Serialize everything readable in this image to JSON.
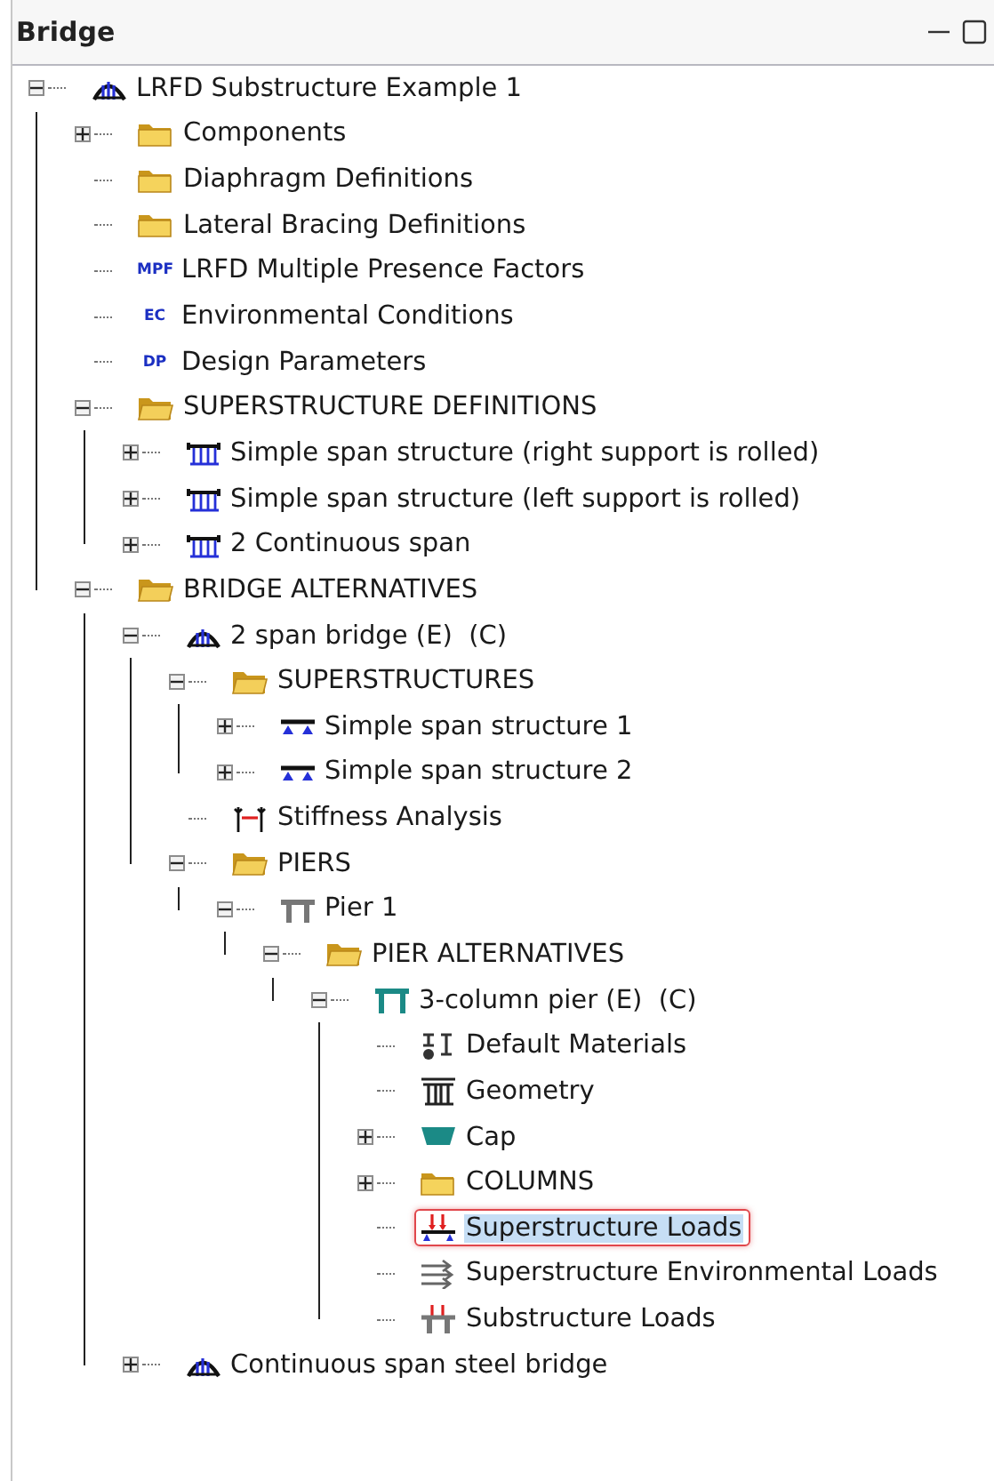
{
  "panel": {
    "title": "Bridge"
  },
  "tree": [
    {
      "label": "LRFD Substructure Example 1",
      "kind": "bridge",
      "expanded": true,
      "selected": false,
      "children": [
        {
          "label": "Components",
          "kind": "folder",
          "expanded": false,
          "selected": false
        },
        {
          "label": "Diaphragm Definitions",
          "kind": "folder",
          "selected": false
        },
        {
          "label": "Lateral Bracing Definitions",
          "kind": "folder",
          "selected": false
        },
        {
          "label": "LRFD Multiple Presence Factors",
          "kind": "badge",
          "badge": "MPF",
          "selected": false
        },
        {
          "label": "Environmental Conditions",
          "kind": "badge",
          "badge": "EC",
          "selected": false
        },
        {
          "label": "Design Parameters",
          "kind": "badge",
          "badge": "DP",
          "selected": false
        },
        {
          "label": "SUPERSTRUCTURE DEFINITIONS",
          "kind": "folder",
          "expanded": true,
          "selected": false,
          "children": [
            {
              "label": "Simple span structure (right support is rolled)",
              "kind": "structure",
              "expanded": false,
              "selected": false
            },
            {
              "label": "Simple span structure (left support is rolled)",
              "kind": "structure",
              "expanded": false,
              "selected": false
            },
            {
              "label": "2 Continuous span",
              "kind": "structure",
              "expanded": false,
              "selected": false
            }
          ]
        },
        {
          "label": "BRIDGE ALTERNATIVES",
          "kind": "folder",
          "expanded": true,
          "selected": false,
          "children": [
            {
              "label": "2 span bridge (E)  (C)",
              "kind": "bridge",
              "expanded": true,
              "selected": false,
              "children": [
                {
                  "label": "SUPERSTRUCTURES",
                  "kind": "folder",
                  "expanded": true,
                  "selected": false,
                  "children": [
                    {
                      "label": "Simple span structure 1",
                      "kind": "girder",
                      "expanded": false,
                      "selected": false
                    },
                    {
                      "label": "Simple span structure 2",
                      "kind": "girder",
                      "expanded": false,
                      "selected": false
                    }
                  ]
                },
                {
                  "label": "Stiffness Analysis",
                  "kind": "stiffness",
                  "selected": false
                },
                {
                  "label": "PIERS",
                  "kind": "folder",
                  "expanded": true,
                  "selected": false,
                  "children": [
                    {
                      "label": "Pier 1",
                      "kind": "pier",
                      "expanded": true,
                      "selected": false,
                      "children": [
                        {
                          "label": "PIER ALTERNATIVES",
                          "kind": "folder",
                          "expanded": true,
                          "selected": false,
                          "children": [
                            {
                              "label": "3-column pier (E)  (C)",
                              "kind": "alternative",
                              "expanded": true,
                              "selected": false,
                              "children": [
                                {
                                  "label": "Default Materials",
                                  "kind": "materials",
                                  "selected": false
                                },
                                {
                                  "label": "Geometry",
                                  "kind": "geometry",
                                  "selected": false
                                },
                                {
                                  "label": "Cap",
                                  "kind": "cap",
                                  "expanded": false,
                                  "selected": false
                                },
                                {
                                  "label": "COLUMNS",
                                  "kind": "folder",
                                  "expanded": false,
                                  "selected": false
                                },
                                {
                                  "label": "Superstructure Loads",
                                  "kind": "load",
                                  "selected": true
                                },
                                {
                                  "label": "Superstructure Environmental Loads",
                                  "kind": "environment",
                                  "selected": false
                                },
                                {
                                  "label": "Substructure Loads",
                                  "kind": "substructure",
                                  "selected": false
                                }
                              ]
                            }
                          ]
                        }
                      ]
                    }
                  ]
                }
              ]
            },
            {
              "label": "Continuous span steel bridge",
              "kind": "bridge",
              "expanded": false,
              "selected": false
            }
          ]
        }
      ]
    }
  ]
}
